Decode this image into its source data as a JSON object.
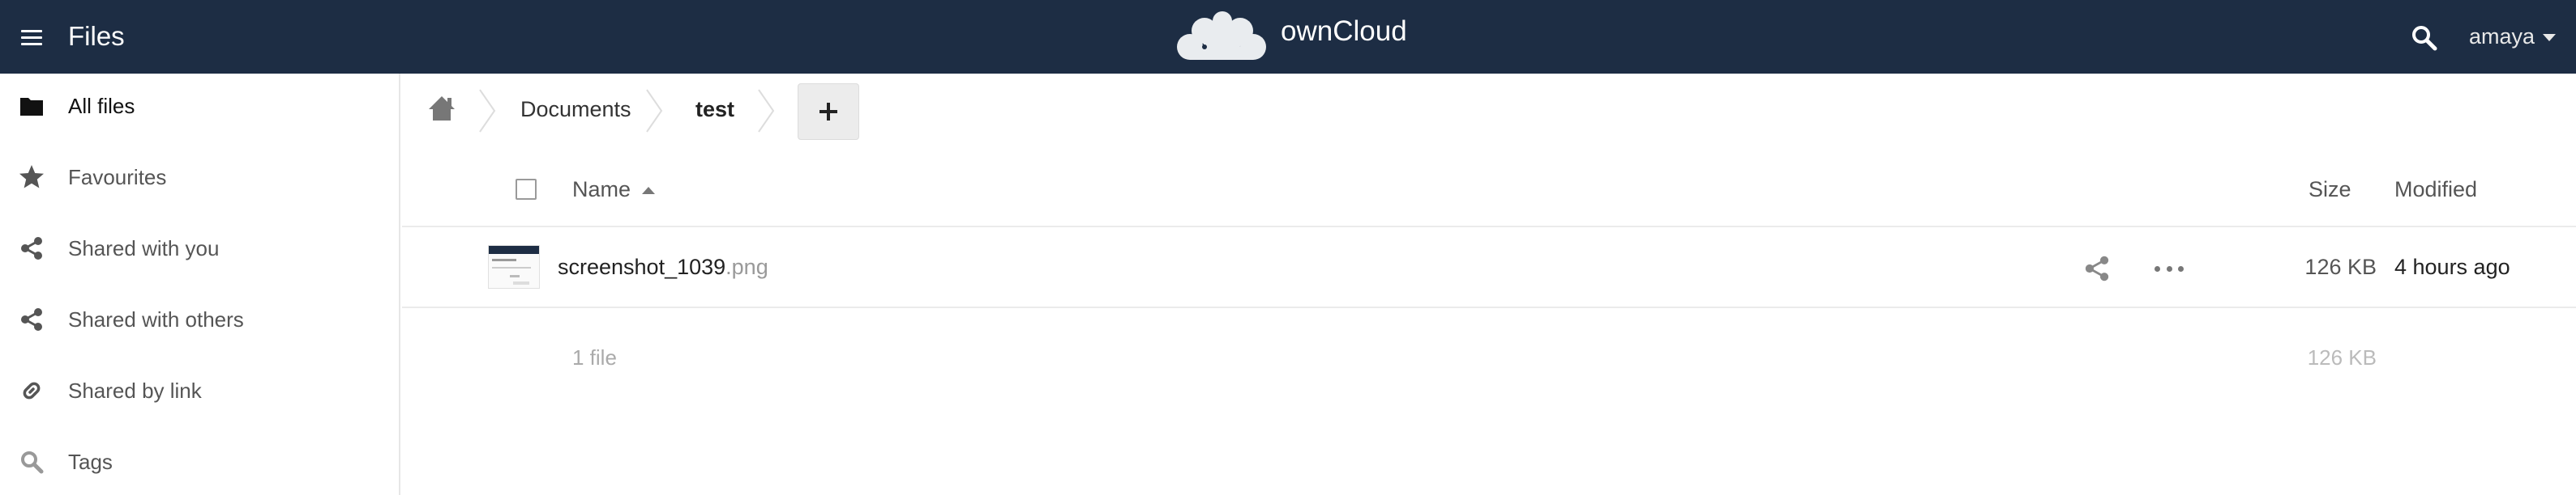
{
  "header": {
    "app_title": "Files",
    "brand_name": "ownCloud",
    "user_name": "amaya",
    "menu_icon": "hamburger-menu-icon",
    "search_icon": "search-icon",
    "logo_icon": "owncloud-cloud-logo",
    "background": "#1d2d44"
  },
  "sidebar": {
    "items": [
      {
        "label": "All files",
        "icon": "folder-icon",
        "active": true
      },
      {
        "label": "Favourites",
        "icon": "star-icon"
      },
      {
        "label": "Shared with you",
        "icon": "share-icon"
      },
      {
        "label": "Shared with others",
        "icon": "share-icon"
      },
      {
        "label": "Shared by link",
        "icon": "link-icon"
      },
      {
        "label": "Tags",
        "icon": "search-icon"
      }
    ]
  },
  "breadcrumb": {
    "home_icon": "home-icon",
    "items": [
      "Documents",
      "test"
    ],
    "new_button_label": "+"
  },
  "table": {
    "columns": {
      "name": "Name",
      "size": "Size",
      "modified": "Modified"
    },
    "sort": "name-ascending",
    "rows": [
      {
        "basename": "screenshot_1039",
        "extension": ".png",
        "size": "126 KB",
        "modified": "4 hours ago"
      }
    ],
    "summary": {
      "count": "1 file",
      "size": "126 KB"
    }
  }
}
